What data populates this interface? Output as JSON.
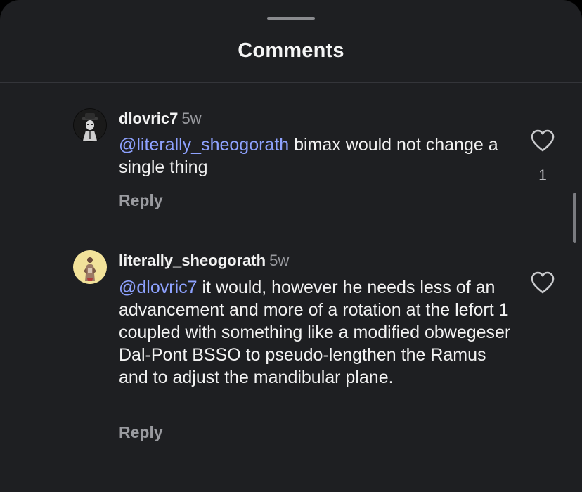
{
  "sheet": {
    "title": "Comments"
  },
  "comments": [
    {
      "username": "dlovric7",
      "time": "5w",
      "mention": "@literally_sheogorath",
      "text": " bimax would not change a single thing",
      "reply_label": "Reply",
      "likes": "1",
      "avatar_icon": "dark-hat-figure-avatar"
    },
    {
      "username": "literally_sheogorath",
      "time": "5w",
      "mention": "@dlovric7",
      "text": " it would, however he needs less of an advancement and more of a rotation at the lefort 1 coupled with something like a modified obwegeser Dal-Pont BSSO to pseudo-lengthen the Ramus and to adjust the mandibular plane.",
      "reply_label": "Reply",
      "avatar_icon": "yellow-figure-avatar"
    }
  ],
  "colors": {
    "background": "#1e1f22",
    "mention": "#8ea2ff",
    "secondary_text": "#9a9ba0",
    "primary_text": "#f2f2f2"
  }
}
